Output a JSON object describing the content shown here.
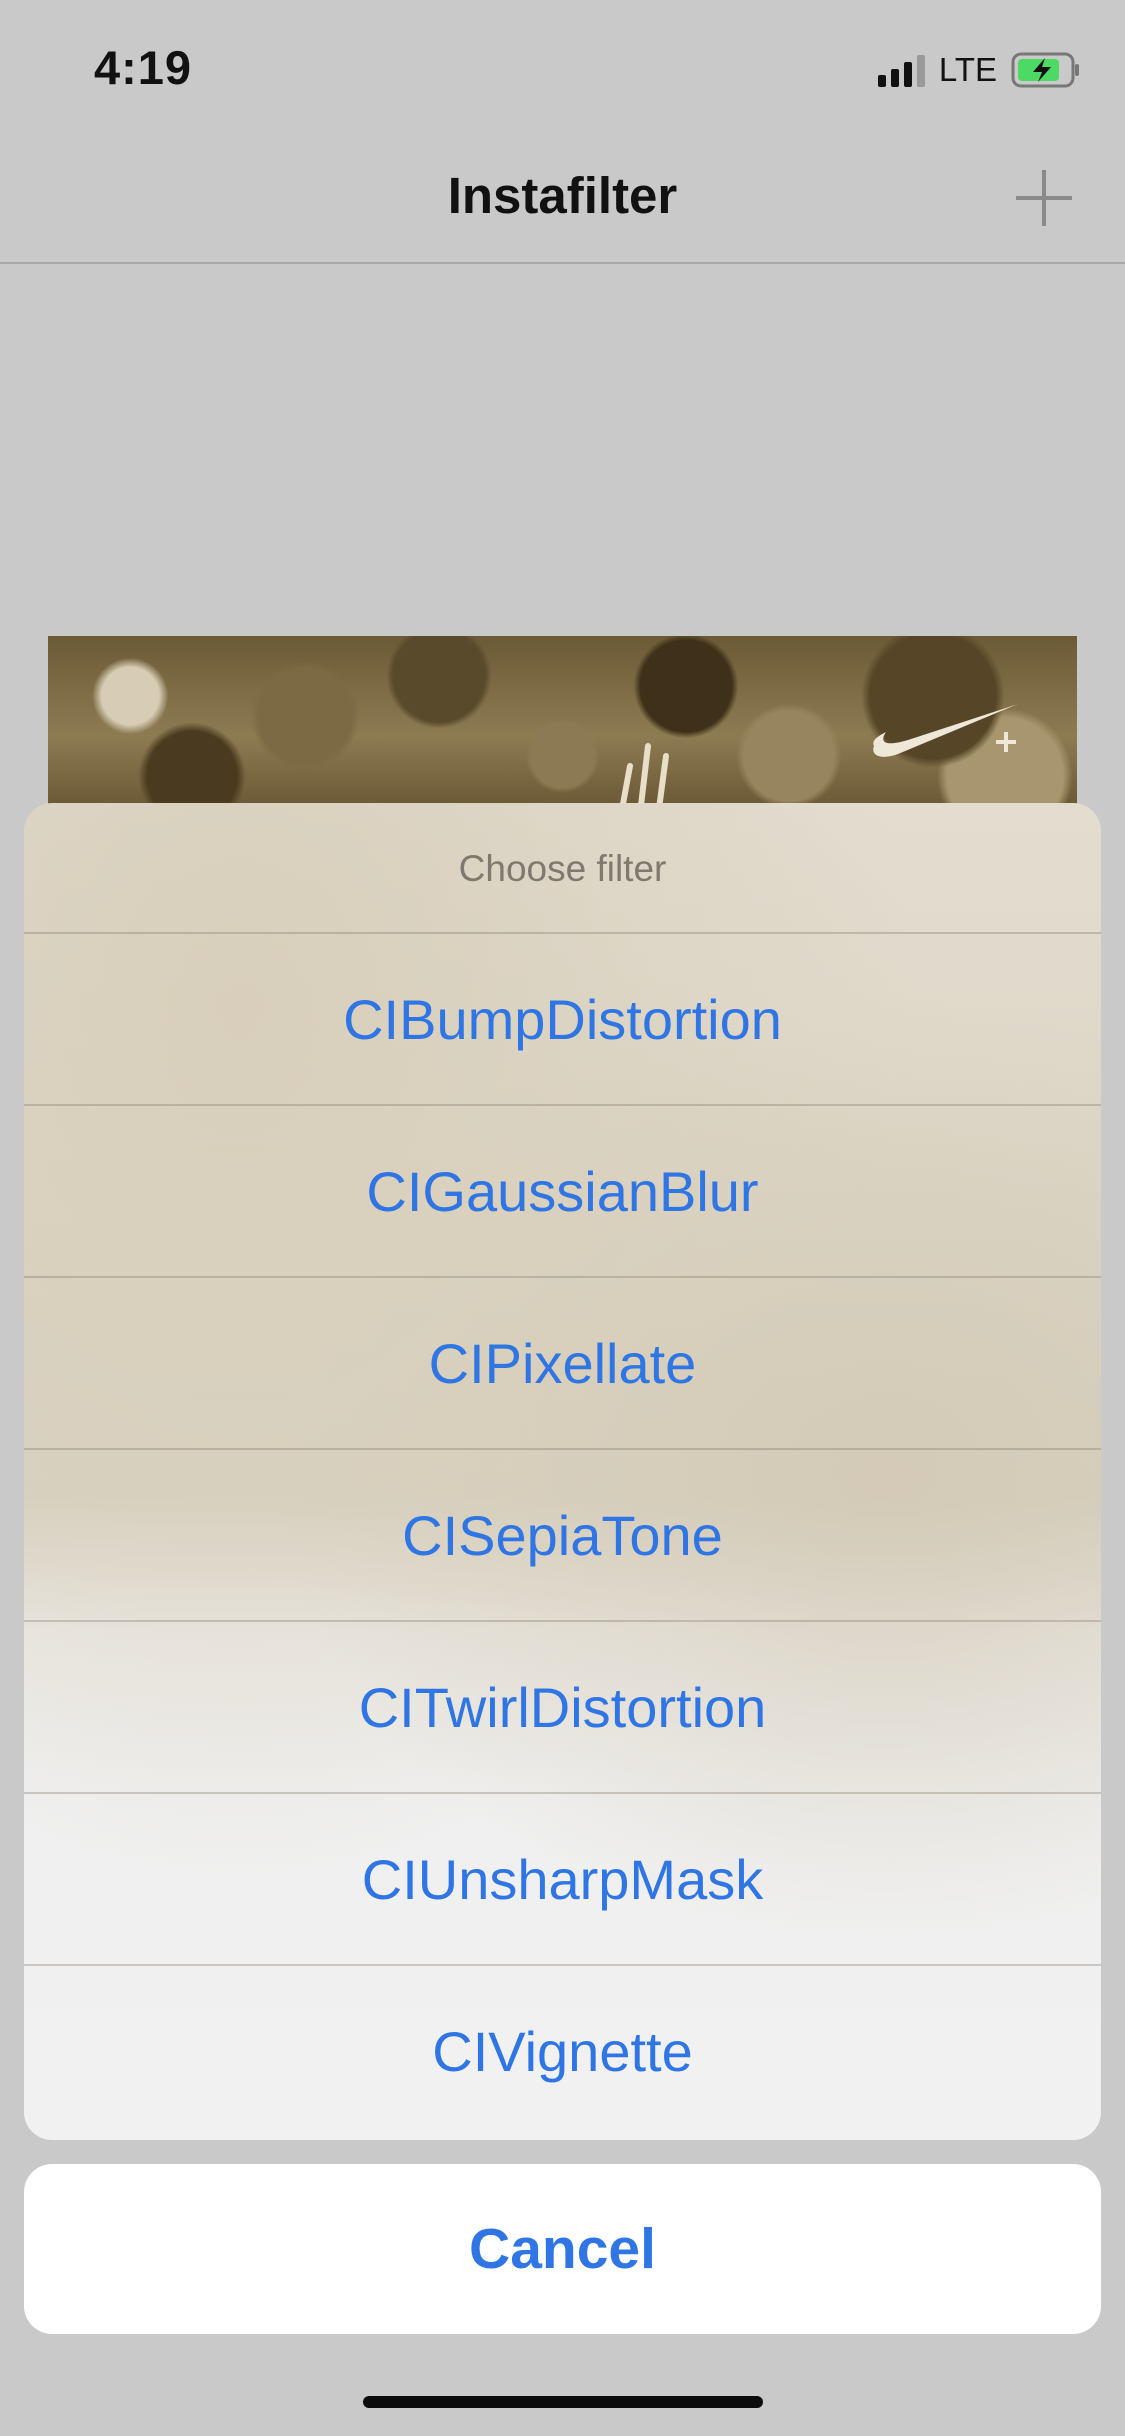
{
  "status_bar": {
    "time": "4:19",
    "network": "LTE",
    "icons": [
      "signal-icon",
      "battery-charging-icon"
    ]
  },
  "nav": {
    "title": "Instafilter",
    "add_icon": "plus-icon"
  },
  "preview": {
    "description_icon": "nike-swoosh-icon"
  },
  "action_sheet": {
    "title": "Choose filter",
    "options": [
      "CIBumpDistortion",
      "CIGaussianBlur",
      "CIPixellate",
      "CISepiaTone",
      "CITwirlDistortion",
      "CIUnsharpMask",
      "CIVignette"
    ],
    "cancel_label": "Cancel"
  },
  "colors": {
    "accent": "#2f76e4",
    "background": "#c9c9c9",
    "battery_fill": "#4cd964"
  }
}
